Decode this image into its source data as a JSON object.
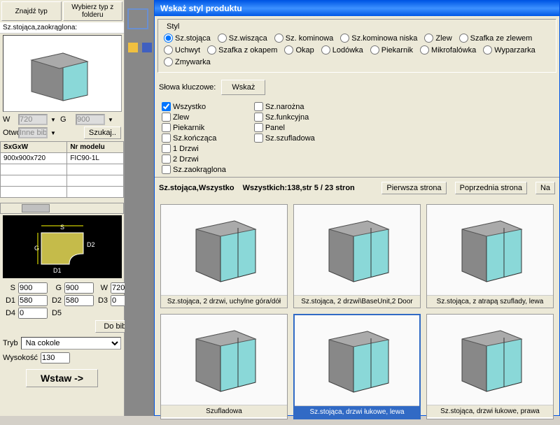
{
  "leftPanel": {
    "findType": "Znajdź typ",
    "chooseFolder": "Wybierz typ z folderu",
    "productLabel": "Sz.stojąca,zaokrąglona:",
    "w": "W",
    "wVal": "720",
    "g": "G",
    "gVal": "900",
    "otw": "Otwó",
    "otwVal": "Inne bibl.",
    "search": "Szukaj..",
    "colSxGxW": "SxGxW",
    "colModel": "Nr modelu",
    "dim": "900x900x720",
    "model": "FIC90-1L",
    "s": "S",
    "sVal": "900",
    "gDim": "G",
    "gDimVal": "900",
    "wDim": "W",
    "wDimVal": "720",
    "d1": "D1",
    "d1Val": "580",
    "d2": "D2",
    "d2Val": "580",
    "d3": "D3",
    "d3Val": "0",
    "d4": "D4",
    "d4Val": "0",
    "d5": "D5",
    "doBibl": "Do bibl.",
    "tryb": "Tryb",
    "trybVal": "Na cokole",
    "wysokosc": "Wysokość",
    "wysokoscVal": "130",
    "insert": "Wstaw ->"
  },
  "dialog": {
    "title": "Wskaż styl produktu",
    "stylLabel": "Styl",
    "radios": [
      "Sz.stojąca",
      "Sz.wisząca",
      "Sz. kominowa",
      "Sz.kominowa niska",
      "Zlew",
      "Szafka ze zlewem",
      "Uchwyt",
      "Szafka z okapem",
      "Okap",
      "Lodówka",
      "Piekarnik",
      "Mikrofalówka",
      "Wyparzarka",
      "Zmywarka"
    ],
    "radioSel": 0,
    "keywordsLabel": "Słowa kluczowe:",
    "wskaz": "Wskaż",
    "checksCol1": [
      "Wszystko",
      "Zlew",
      "Piekarnik",
      "Sz.kończąca",
      "1 Drzwi",
      "2 Drzwi",
      "Sz.zaokrąglona"
    ],
    "checksCol2": [
      "Sz.narożna",
      "Sz.funkcyjna",
      "Panel",
      "Sz.szufladowa"
    ],
    "checkSel": 0,
    "resultLabel": "Sz.stojąca,Wszystko",
    "resultCount": "Wszystkich:138,str 5 / 23 stron",
    "firstPage": "Pierwsza strona",
    "prevPage": "Poprzednia strona",
    "na": "Na",
    "cards": [
      {
        "label": "Sz.stojąca, 2 drzwi, uchylne góra/dół"
      },
      {
        "label": "Sz.stojąca, 2 drzwi\\BaseUnit,2 Door"
      },
      {
        "label": "Sz.stojąca, z atrapą szuflady, lewa"
      },
      {
        "label": "Szufladowa"
      },
      {
        "label": "Sz.stojąca, drzwi łukowe, lewa",
        "selected": true
      },
      {
        "label": "Sz.stojąca, drzwi łukowe, prawa"
      }
    ]
  }
}
